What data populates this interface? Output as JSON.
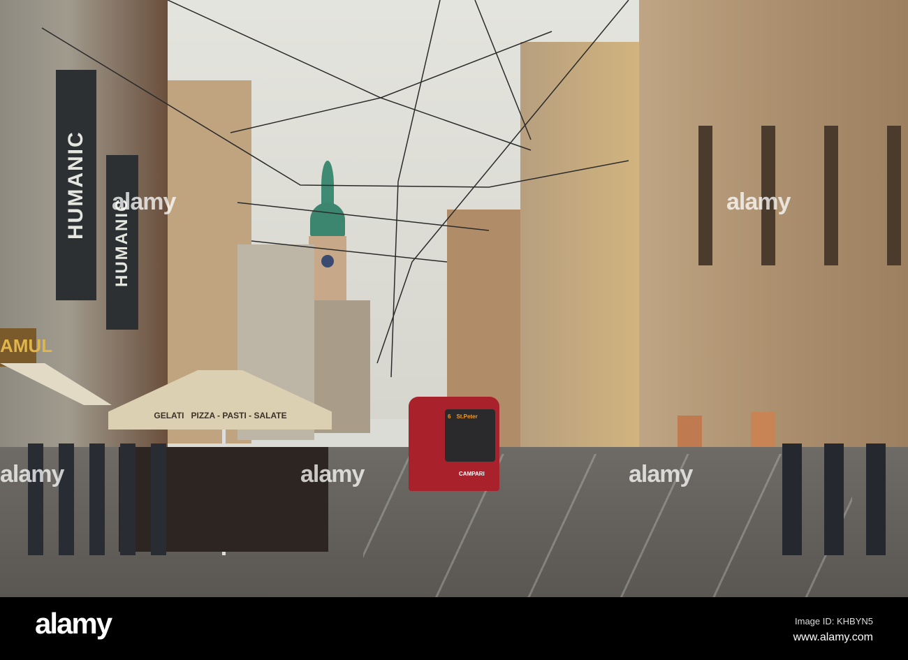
{
  "photo": {
    "banners": [
      "HUMANIC",
      "HUMANIC"
    ],
    "umbrella_text": "GELATI   PIZZA - PASTI - SALATE",
    "tram": {
      "route": "6",
      "destination": "St.Peter",
      "ad": "CAMPARI",
      "color": "#b0202a"
    },
    "shop_sign": "AMUL"
  },
  "watermark": {
    "text": "alamy"
  },
  "footer": {
    "logo": "alamy",
    "image_id": "Image ID: KHBYN5",
    "url": "www.alamy.com"
  }
}
